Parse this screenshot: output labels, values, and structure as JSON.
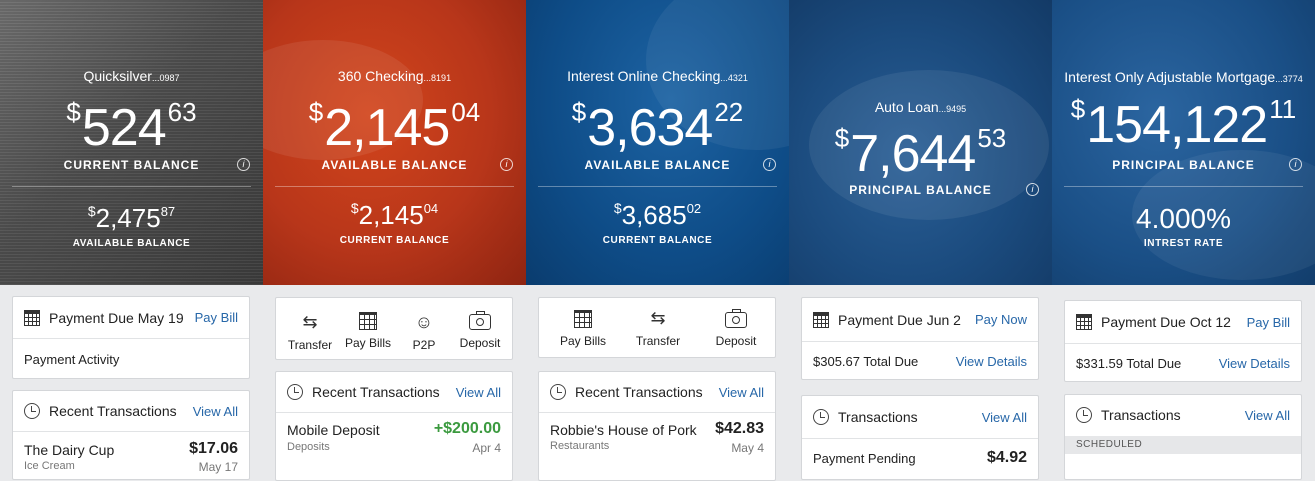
{
  "accounts": [
    {
      "name": "Quicksilver",
      "suffix": "...0987",
      "primary": {
        "currency": "$",
        "whole": "524",
        "cents": "63",
        "label": "CURRENT BALANCE"
      },
      "secondary": {
        "currency": "$",
        "whole": "2,475",
        "cents": "87",
        "label": "AVAILABLE BALANCE"
      }
    },
    {
      "name": "360 Checking",
      "suffix": "...8191",
      "primary": {
        "currency": "$",
        "whole": "2,145",
        "cents": "04",
        "label": "AVAILABLE BALANCE"
      },
      "secondary": {
        "currency": "$",
        "whole": "2,145",
        "cents": "04",
        "label": "CURRENT BALANCE"
      }
    },
    {
      "name": "Interest Online Checking",
      "suffix": "...4321",
      "primary": {
        "currency": "$",
        "whole": "3,634",
        "cents": "22",
        "label": "AVAILABLE BALANCE"
      },
      "secondary": {
        "currency": "$",
        "whole": "3,685",
        "cents": "02",
        "label": "CURRENT BALANCE"
      }
    },
    {
      "name": "Auto Loan",
      "suffix": "...9495",
      "primary": {
        "currency": "$",
        "whole": "7,644",
        "cents": "53",
        "label": "PRINCIPAL BALANCE"
      }
    },
    {
      "name": "Interest Only Adjustable Mortgage",
      "suffix": "...3774",
      "primary": {
        "currency": "$",
        "whole": "154,122",
        "cents": "11",
        "label": "PRINCIPAL BALANCE"
      },
      "secondary": {
        "value": "4.000%",
        "label": "INTREST RATE"
      }
    }
  ],
  "info_glyph": "i",
  "col0": {
    "payment_due": "Payment Due May 19",
    "pay_bill": "Pay Bill",
    "payment_activity": "Payment Activity",
    "recent_title": "Recent Transactions",
    "view_all": "View All",
    "tx": {
      "name": "The Dairy Cup",
      "sub": "Ice Cream",
      "amount": "$17.06",
      "date": "May 17"
    }
  },
  "col1": {
    "actions": [
      {
        "label": "Transfer",
        "glyph": "⇆"
      },
      {
        "label": "Pay Bills",
        "glyph": ""
      },
      {
        "label": "P2P",
        "glyph": "☺"
      },
      {
        "label": "Deposit",
        "glyph": ""
      }
    ],
    "recent_title": "Recent Transactions",
    "view_all": "View All",
    "tx": {
      "name": "Mobile Deposit",
      "sub": "Deposits",
      "amount": "+$200.00",
      "date": "Apr 4"
    }
  },
  "col2": {
    "actions": [
      {
        "label": "Pay Bills",
        "glyph": ""
      },
      {
        "label": "Transfer",
        "glyph": "⇆"
      },
      {
        "label": "Deposit",
        "glyph": ""
      }
    ],
    "recent_title": "Recent Transactions",
    "view_all": "View All",
    "tx": {
      "name": "Robbie's House of Pork",
      "sub": "Restaurants",
      "amount": "$42.83",
      "date": "May 4"
    }
  },
  "col3": {
    "payment_due": "Payment Due Jun 2",
    "pay_now": "Pay Now",
    "total_due": "$305.67 Total Due",
    "view_details": "View Details",
    "tx_title": "Transactions",
    "view_all": "View All",
    "tx": {
      "name": "Payment Pending",
      "amount": "$4.92"
    }
  },
  "col4": {
    "payment_due": "Payment Due Oct 12",
    "pay_bill": "Pay Bill",
    "total_due": "$331.59 Total Due",
    "view_details": "View Details",
    "tx_title": "Transactions",
    "view_all": "View All",
    "scheduled": "SCHEDULED"
  },
  "colors": {
    "link": "#2767a8",
    "positive": "#3b9a3f"
  }
}
